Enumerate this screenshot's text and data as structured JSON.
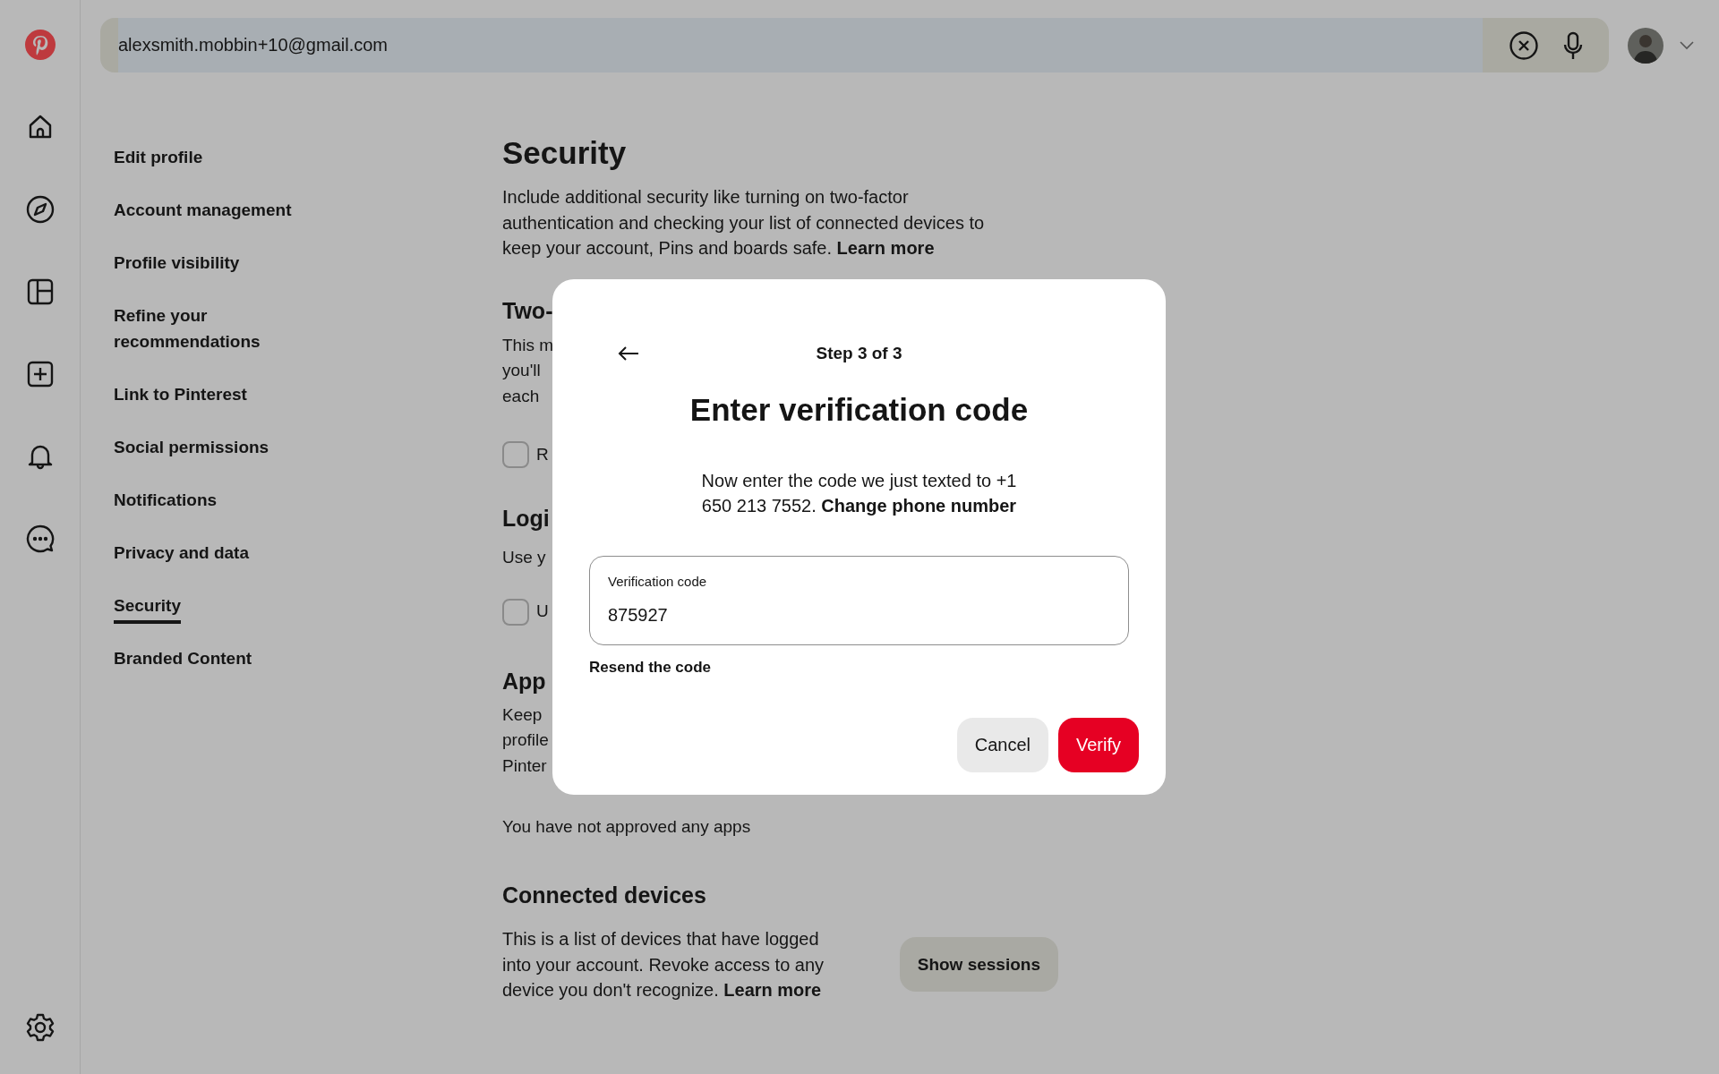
{
  "search": {
    "value": "alexsmith.mobbin+10@gmail.com",
    "text_selected": true
  },
  "settings_nav": [
    {
      "label": "Edit profile",
      "selected": false
    },
    {
      "label": "Account management",
      "selected": false
    },
    {
      "label": "Profile visibility",
      "selected": false
    },
    {
      "label": "Refine your recommendations",
      "selected": false
    },
    {
      "label": "Link to Pinterest",
      "selected": false
    },
    {
      "label": "Social permissions",
      "selected": false
    },
    {
      "label": "Notifications",
      "selected": false
    },
    {
      "label": "Privacy and data",
      "selected": false
    },
    {
      "label": "Security",
      "selected": true
    },
    {
      "label": "Branded Content",
      "selected": false
    }
  ],
  "page": {
    "title": "Security",
    "intro": {
      "text": "Include additional security like turning on two-factor authentication and checking your list of connected devices to keep your account, Pins and boards safe.",
      "link": "Learn more"
    },
    "two_factor": {
      "heading": "Two-",
      "lines": [
        "This m",
        "you'll",
        "each"
      ],
      "checkbox": {
        "label": "R",
        "checked": false
      }
    },
    "login": {
      "heading": "Logi",
      "lines": [
        "Use y"
      ],
      "checkbox": {
        "label": "U",
        "checked": false
      }
    },
    "apps": {
      "heading": "App",
      "lines": [
        "Keep",
        "profile",
        "Pinter"
      ],
      "note": "You have not approved any apps"
    },
    "connected_devices": {
      "heading": "Connected devices",
      "text": "This is a list of devices that have logged into your account. Revoke access to any device you don't recognize.",
      "link": "Learn more",
      "button": "Show sessions"
    }
  },
  "dialog": {
    "step": "Step 3 of 3",
    "title": "Enter verification code",
    "description": {
      "text": "Now enter the code we just texted to +1 650 213 7552.",
      "link": "Change phone number"
    },
    "field": {
      "label": "Verification code",
      "value": "875927"
    },
    "resend": "Resend the code",
    "buttons": [
      {
        "label": "Cancel",
        "kind": "secondary"
      },
      {
        "label": "Verify",
        "kind": "primary"
      }
    ]
  }
}
